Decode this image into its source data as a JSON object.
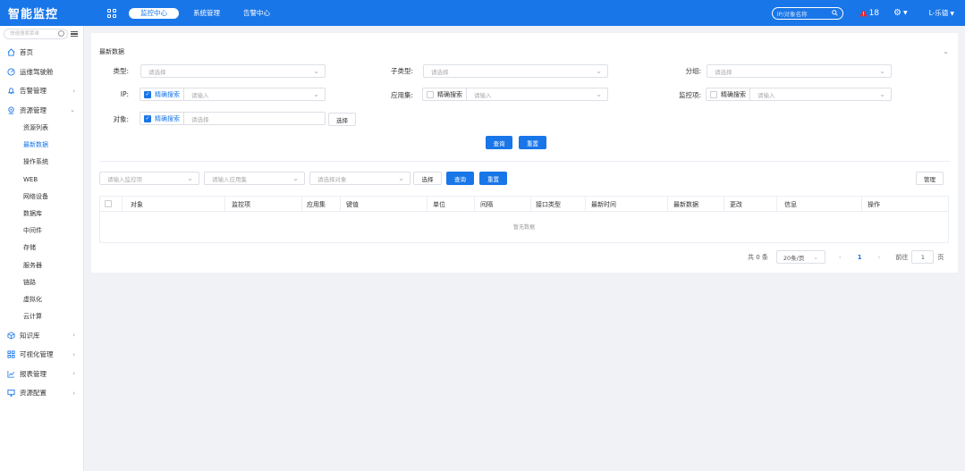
{
  "header": {
    "title": "智能监控",
    "nav": [
      "监控中心",
      "系统管理",
      "告警中心"
    ],
    "search_placeholder": "IP/对象名称",
    "alert_count": "18",
    "user": "L-乐德",
    "accent": "#1976e8",
    "alert_color": "#f5222d"
  },
  "sidebar": {
    "search_placeholder": "快速搜索菜单",
    "items": [
      {
        "label": "首页",
        "icon": "home-icon"
      },
      {
        "label": "运维驾驶舱",
        "icon": "dashboard-icon"
      },
      {
        "label": "告警管理",
        "icon": "bell-icon"
      },
      {
        "label": "资源管理",
        "icon": "location-icon"
      }
    ],
    "sub_items": [
      "资源列表",
      "最新数据",
      "操作系统",
      "WEB",
      "网络设备",
      "数据库",
      "中间件",
      "存储",
      "服务器",
      "链路",
      "虚拟化",
      "云计算"
    ],
    "bottom_items": [
      {
        "label": "知识库",
        "icon": "cube-icon"
      },
      {
        "label": "可视化管理",
        "icon": "grid-icon"
      },
      {
        "label": "报表管理",
        "icon": "chart-icon"
      },
      {
        "label": "资源配置",
        "icon": "monitor-icon"
      }
    ]
  },
  "main": {
    "title": "最新数据",
    "filters": {
      "type_label": "类型:",
      "type_placeholder": "请选择",
      "subtype_label": "子类型:",
      "subtype_placeholder": "请选择",
      "group_label": "分组:",
      "group_placeholder": "请选择",
      "ip_label": "IP:",
      "exact_search": "精确搜索",
      "input_placeholder": "请输入",
      "appset_label": "应用集:",
      "item_label": "监控项:",
      "object_label": "对象:",
      "object_placeholder": "请选择",
      "choose": "选择",
      "query": "查询",
      "reset": "重置"
    },
    "toolbar": {
      "item_placeholder": "请输入监控项",
      "app_placeholder": "请输入应用集",
      "object_placeholder": "请选择对象",
      "choose": "选择",
      "query": "查询",
      "reset": "重置",
      "manage": "管理"
    },
    "table": {
      "columns": [
        "对象",
        "监控项",
        "应用集",
        "键值",
        "单位",
        "间隔",
        "接口类型",
        "最新时间",
        "最新数据",
        "更改",
        "信息",
        "操作"
      ],
      "empty": "暂无数据"
    },
    "pager": {
      "total": "共 0 条",
      "page_size": "20条/页",
      "current": "1",
      "goto": "前往",
      "goto_value": "1",
      "page_unit": "页"
    }
  }
}
